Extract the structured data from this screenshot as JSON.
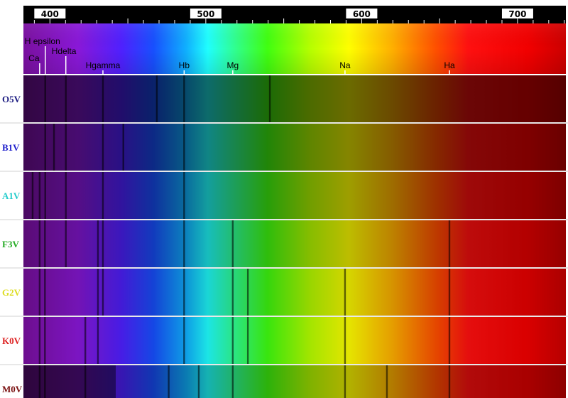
{
  "axis": {
    "unit": "nm",
    "range": [
      383,
      731
    ],
    "ticks": [
      {
        "value": 400,
        "label": "400"
      },
      {
        "value": 500,
        "label": "500"
      },
      {
        "value": 600,
        "label": "600"
      },
      {
        "value": 700,
        "label": "700"
      }
    ]
  },
  "lines": [
    {
      "name": "Ca",
      "label": "Ca",
      "wavelength": 393.4,
      "label_row": 4
    },
    {
      "name": "H epsilon",
      "label": "H epsilon",
      "wavelength": 397.0,
      "label_row": 1
    },
    {
      "name": "Hdelta",
      "label": "Hdelta",
      "wavelength": 410.2,
      "label_row": 2
    },
    {
      "name": "Hgamma",
      "label": "Hgamma",
      "wavelength": 434.0,
      "label_row": 5
    },
    {
      "name": "Hb",
      "label": "Hb",
      "wavelength": 486.1,
      "label_row": 5
    },
    {
      "name": "Mg",
      "label": "Mg",
      "wavelength": 517.3,
      "label_row": 5
    },
    {
      "name": "Na",
      "label": "Na",
      "wavelength": 589.3,
      "label_row": 5
    },
    {
      "name": "Ha",
      "label": "Ha",
      "wavelength": 656.3,
      "label_row": 5
    }
  ],
  "spectra": [
    {
      "class": "O5V",
      "label_color": "#1a1a80",
      "lines": [
        397.0,
        410.2,
        434.0,
        486.1,
        468.6,
        541.1
      ]
    },
    {
      "class": "B1V",
      "label_color": "#2020cc",
      "lines": [
        397.0,
        410.2,
        434.0,
        486.1,
        447.1,
        402.6
      ]
    },
    {
      "class": "A1V",
      "label_color": "#22cccc",
      "lines": [
        388.9,
        397.0,
        410.2,
        434.0,
        486.1,
        393.4
      ]
    },
    {
      "class": "F3V",
      "label_color": "#22aa22",
      "lines": [
        393.4,
        396.8,
        410.2,
        434.0,
        486.1,
        430.8,
        517.3,
        656.3
      ]
    },
    {
      "class": "G2V",
      "label_color": "#dddd22",
      "lines": [
        393.4,
        396.8,
        430.8,
        434.0,
        486.1,
        517.3,
        527.0,
        589.3,
        656.3
      ]
    },
    {
      "class": "K0V",
      "label_color": "#dd2222",
      "lines": [
        393.4,
        396.8,
        422.7,
        430.8,
        486.1,
        517.3,
        527.0,
        589.3,
        656.3
      ]
    },
    {
      "class": "M0V",
      "label_color": "#7a1010",
      "lines": [
        393.4,
        396.8,
        422.7,
        476.2,
        495.5,
        517.3,
        589.3,
        616.2,
        656.3
      ]
    }
  ]
}
